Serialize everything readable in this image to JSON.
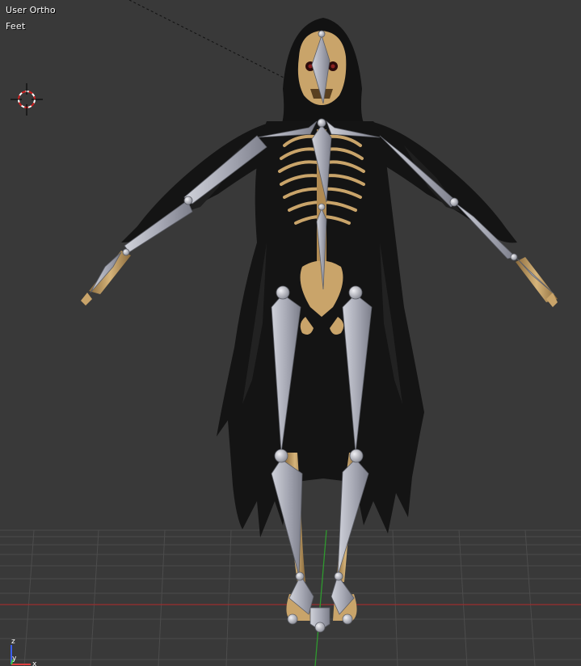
{
  "viewport": {
    "view_name": "User Ortho",
    "unit_label": "Feet",
    "background_color": "#393939",
    "grid_color": "#4a4a4a",
    "x_axis_color": "#a03030",
    "y_axis_color": "#2f9a2f"
  },
  "axis_widget": {
    "z_label": "z",
    "y_label": "y",
    "x_label": "x",
    "z_color": "#3a5ef0",
    "y_color": "#35c235",
    "x_color": "#e04040"
  },
  "scene": {
    "object": "hooded-skeleton-character",
    "armature_color": "#a8aab6",
    "bone_color": "#c8a36a",
    "robe_color": "#151515",
    "cursor_icon": "3d-cursor-icon"
  }
}
